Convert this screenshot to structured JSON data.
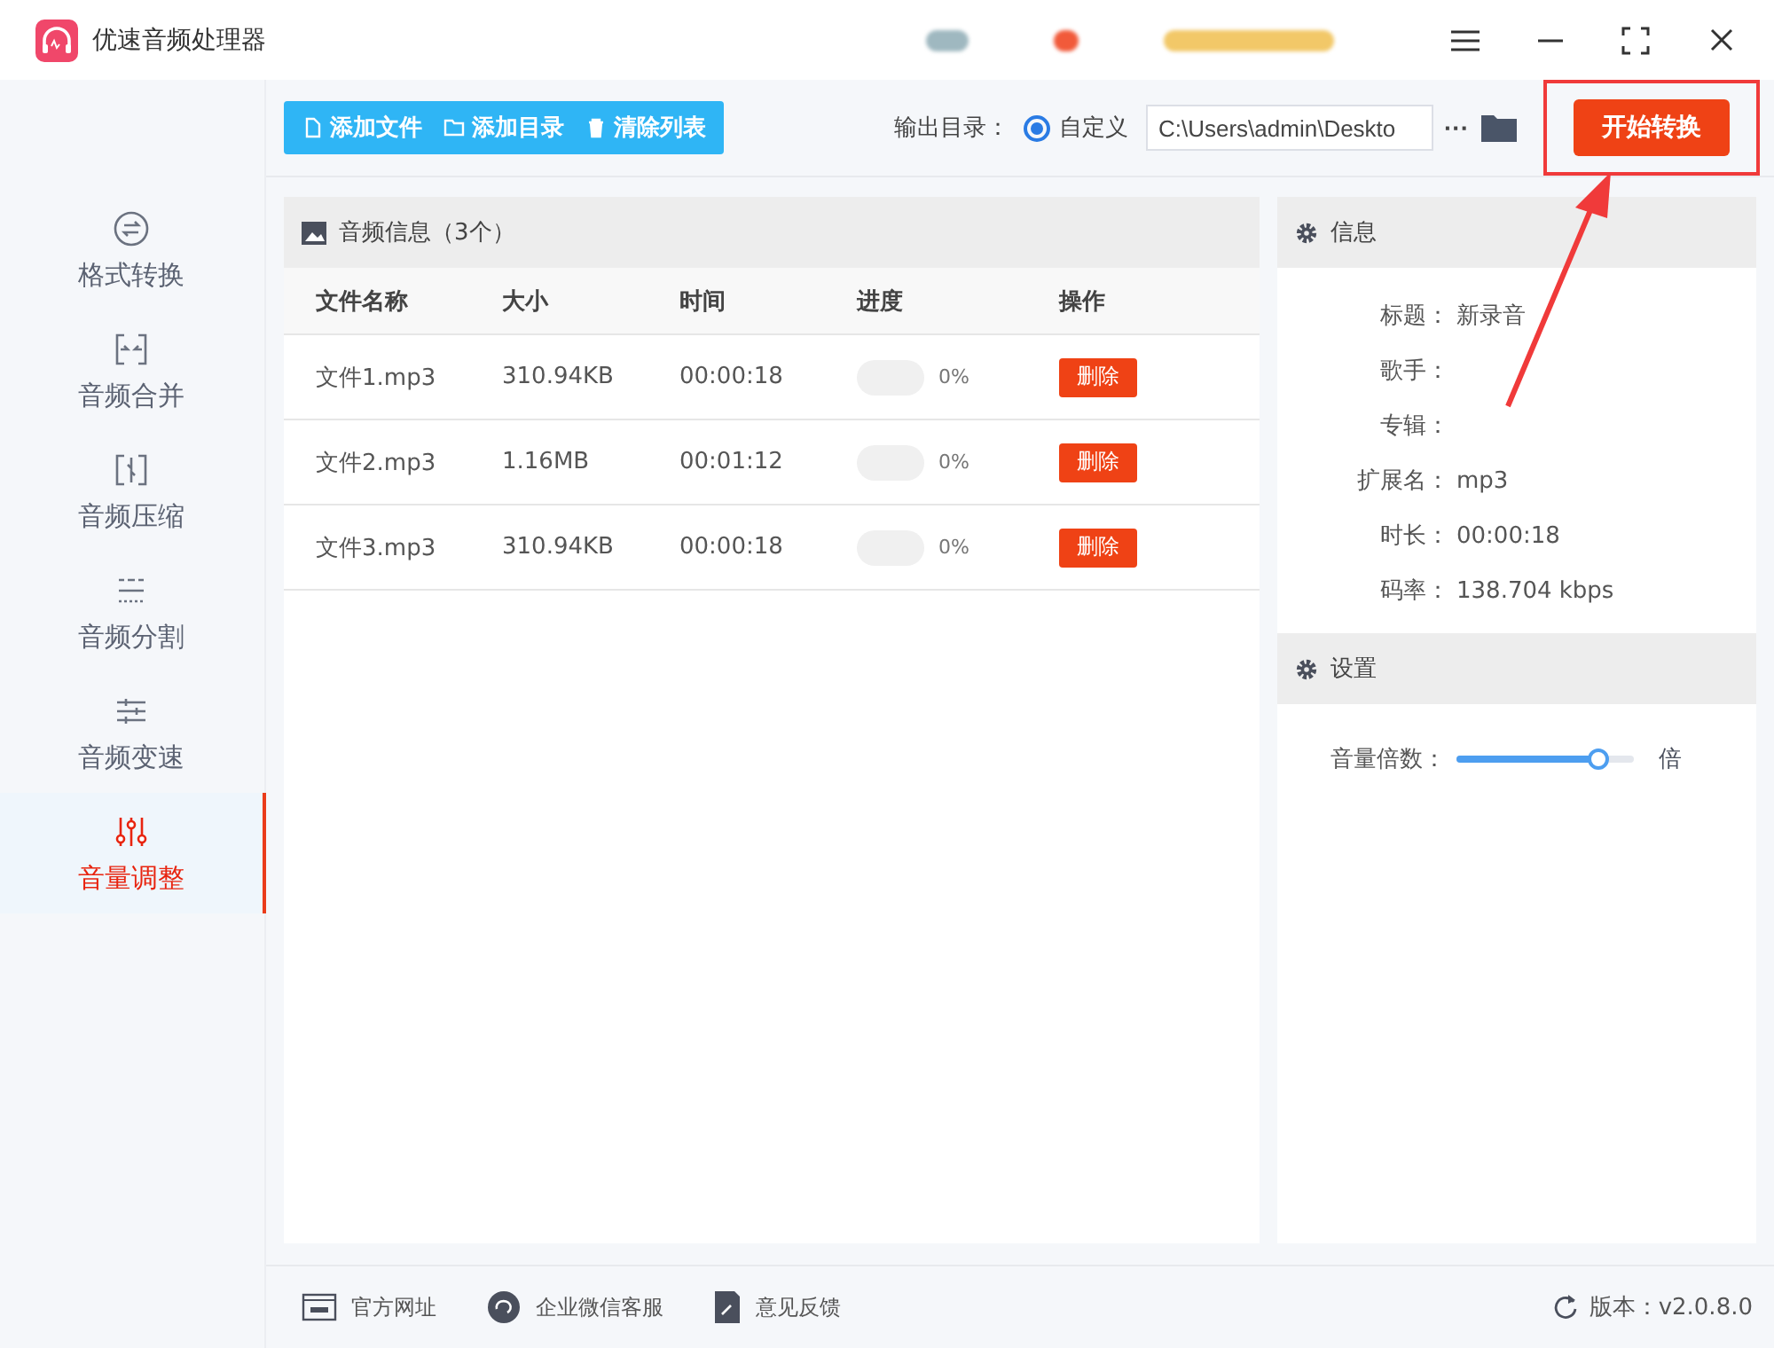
{
  "window": {
    "title": "优速音频处理器"
  },
  "sidebar": {
    "items": [
      {
        "label": "格式转换",
        "selected": false
      },
      {
        "label": "音频合并",
        "selected": false
      },
      {
        "label": "音频压缩",
        "selected": false
      },
      {
        "label": "音频分割",
        "selected": false
      },
      {
        "label": "音频变速",
        "selected": false
      },
      {
        "label": "音量调整",
        "selected": true
      }
    ]
  },
  "toolbar": {
    "buttons": [
      {
        "label": "添加文件"
      },
      {
        "label": "添加目录"
      },
      {
        "label": "清除列表"
      }
    ],
    "output_label": "输出目录：",
    "radio": {
      "label": "自定义",
      "selected": true
    },
    "path": "C:\\Users\\admin\\Deskto",
    "more": "···",
    "start": "开始转换"
  },
  "file_panel": {
    "title": "音频信息（3个）",
    "columns": [
      "文件名称",
      "大小",
      "时间",
      "进度",
      "操作"
    ],
    "rows": [
      {
        "name": "文件1.mp3",
        "size": "310.94KB",
        "time": "00:00:18",
        "progress": "0%",
        "action": "删除"
      },
      {
        "name": "文件2.mp3",
        "size": "1.16MB",
        "time": "00:01:12",
        "progress": "0%",
        "action": "删除"
      },
      {
        "name": "文件3.mp3",
        "size": "310.94KB",
        "time": "00:00:18",
        "progress": "0%",
        "action": "删除"
      }
    ]
  },
  "info_panel": {
    "title": "信息",
    "fields": [
      {
        "label": "标题：",
        "value": "新录音"
      },
      {
        "label": "歌手："
      },
      {
        "label": "专辑："
      },
      {
        "label": "扩展名：",
        "value": "mp3"
      },
      {
        "label": "时长：",
        "value": "00:00:18"
      },
      {
        "label": "码率：",
        "value": "138.704 kbps"
      }
    ]
  },
  "settings_panel": {
    "title": "设置",
    "slider": {
      "label": "音量倍数：",
      "level": 0.8,
      "unit": "倍"
    }
  },
  "footer": {
    "links": [
      {
        "label": "官方网址"
      },
      {
        "label": "企业微信客服"
      },
      {
        "label": "意见反馈"
      }
    ],
    "version": "版本：v2.0.8.0"
  }
}
